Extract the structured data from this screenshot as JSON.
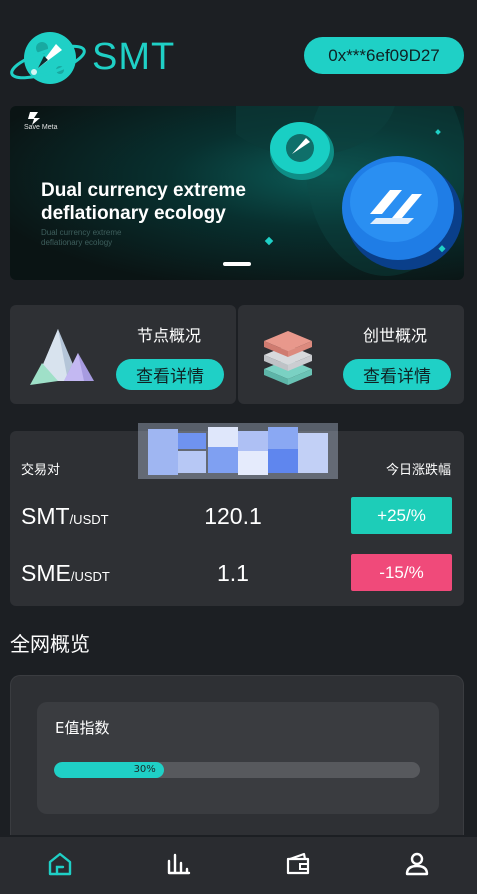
{
  "header": {
    "brand": "SMT",
    "address": "0x***6ef09D27"
  },
  "banner": {
    "brand_small": "Save Meta",
    "headline_line1": "Dual currency extreme",
    "headline_line2": "deflationary ecology",
    "sub_line1": "Dual currency extreme",
    "sub_line2": "deflationary ecology"
  },
  "cards": [
    {
      "title": "节点概况",
      "button": "查看详情",
      "icon": "pyramid-icon"
    },
    {
      "title": "创世概况",
      "button": "查看详情",
      "icon": "layers-icon"
    }
  ],
  "market": {
    "col_pair": "交易对",
    "col_change": "今日涨跌幅",
    "rows": [
      {
        "base": "SMT",
        "quote": "/USDT",
        "price": "120.1",
        "change": "+25/%"
      },
      {
        "base": "SME",
        "quote": "/USDT",
        "price": "1.1",
        "change": "-15/%"
      }
    ]
  },
  "overview": {
    "title": "全网概览",
    "index_label": "E值指数",
    "progress_value": 0.3,
    "progress_text": "30%"
  },
  "nav": [
    {
      "icon": "home-icon",
      "active": true
    },
    {
      "icon": "chart-bars-icon",
      "active": false
    },
    {
      "icon": "wallet-icon",
      "active": false
    },
    {
      "icon": "user-icon",
      "active": false
    }
  ],
  "colors": {
    "accent": "#1fd0c6",
    "up": "#1dcdb8",
    "down": "#f04a7a",
    "background": "#1c1f23",
    "card": "#2e3034"
  }
}
